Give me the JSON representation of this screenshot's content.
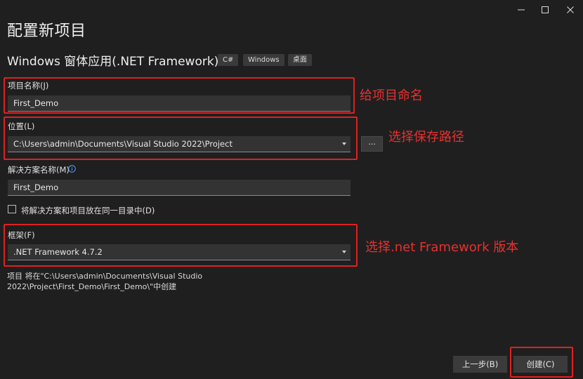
{
  "window": {
    "controls": [
      "minimize-icon",
      "maximize-icon",
      "close-icon"
    ]
  },
  "page_title": "配置新项目",
  "template": {
    "name": "Windows 窗体应用(.NET Framework)",
    "tags": [
      "C#",
      "Windows",
      "桌面"
    ]
  },
  "project_name": {
    "label": "项目名称(J)",
    "value": "First_Demo"
  },
  "location": {
    "label": "位置(L)",
    "value": "C:\\Users\\admin\\Documents\\Visual Studio 2022\\Project",
    "browse_label": "..."
  },
  "solution_name": {
    "label": "解决方案名称(M)",
    "value": "First_Demo"
  },
  "same_directory": {
    "label": "将解决方案和项目放在同一目录中(D)",
    "checked": false
  },
  "framework": {
    "label": "框架(F)",
    "value": ".NET Framework 4.7.2"
  },
  "info_text": "项目 将在\"C:\\Users\\admin\\Documents\\Visual Studio 2022\\Project\\First_Demo\\First_Demo\\\"中创建",
  "annotations": {
    "name": "给项目命名",
    "location": "选择保存路径",
    "framework": "选择.net Framework 版本"
  },
  "buttons": {
    "back": "上一步(B)",
    "create": "创建(C)"
  },
  "colors": {
    "background": "#1f1f1f",
    "annotation_red": "#e02020"
  }
}
